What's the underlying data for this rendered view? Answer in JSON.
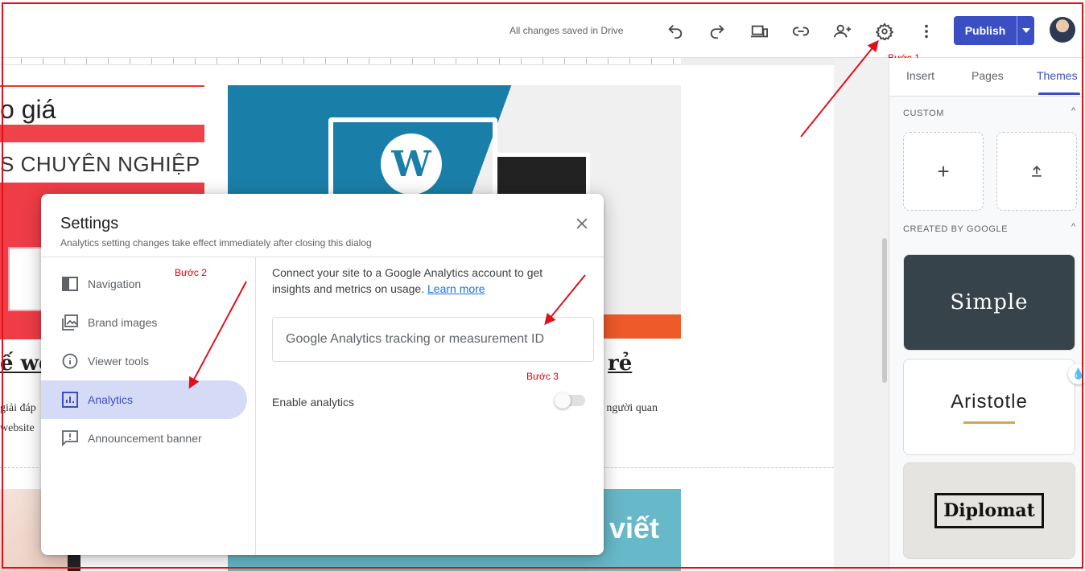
{
  "topbar": {
    "saved_status": "All changes saved in Drive",
    "publish_label": "Publish",
    "icons": [
      "undo-icon",
      "redo-icon",
      "preview-devices-icon",
      "link-icon",
      "share-person-add-icon",
      "settings-gear-icon",
      "more-vert-icon",
      "chevron-down-icon"
    ]
  },
  "annotations": {
    "step1": "Bước 1",
    "step2": "Bước 2",
    "step3": "Bước 3",
    "color": "#e0101a"
  },
  "canvas": {
    "text1": "o giá",
    "text2": "S CHUYÊN NGHIỆP",
    "heading_left": "ế we",
    "heading_right": "rẻ",
    "para_left_1": "giải đáp",
    "para_left_2": "website",
    "para_right": "i người quan",
    "wp_letter": "W",
    "img_text": "viết"
  },
  "panel": {
    "tabs": [
      {
        "label": "Insert",
        "active": false
      },
      {
        "label": "Pages",
        "active": false
      },
      {
        "label": "Themes",
        "active": true
      }
    ],
    "custom_label": "CUSTOM",
    "created_label": "CREATED BY GOOGLE",
    "caret": "^",
    "add_glyph": "+",
    "themes": [
      "Simple",
      "Aristotle",
      "Diplomat"
    ]
  },
  "dialog": {
    "title": "Settings",
    "subtitle": "Analytics setting changes take effect immediately after closing this dialog",
    "nav": [
      {
        "label": "Navigation",
        "icon": "navigation-icon",
        "active": false
      },
      {
        "label": "Brand images",
        "icon": "image-icon",
        "active": false
      },
      {
        "label": "Viewer tools",
        "icon": "info-icon",
        "active": false
      },
      {
        "label": "Analytics",
        "icon": "analytics-icon",
        "active": true
      },
      {
        "label": "Announcement banner",
        "icon": "announcement-icon",
        "active": false
      }
    ],
    "description": "Connect your site to a Google Analytics account to get insights and metrics on usage.",
    "learn_more": "Learn more",
    "input_placeholder": "Google Analytics tracking or measurement ID",
    "input_value": "",
    "enable_label": "Enable analytics",
    "enable_state": false
  },
  "colors": {
    "accent": "#3b4fc4",
    "nav_active_bg": "#d5dbf7",
    "annotation": "#e0101a",
    "canvas_red": "#ef3d47",
    "theme_simple_bg": "#36434b",
    "aristotle_line": "#d4a64e"
  }
}
